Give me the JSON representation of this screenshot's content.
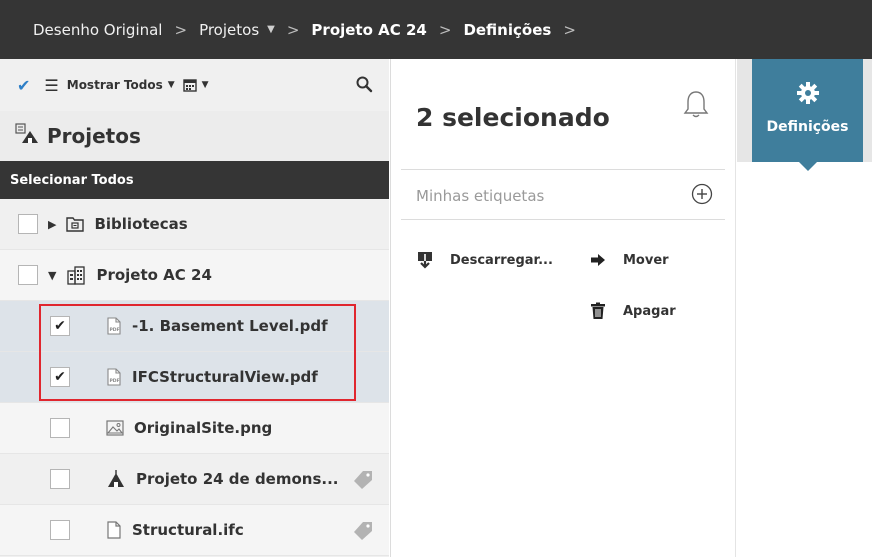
{
  "breadcrumb": {
    "items": [
      {
        "label": "Desenho Original"
      },
      {
        "label": "Projetos"
      },
      {
        "label": "Projeto AC 24"
      },
      {
        "label": "Definições"
      }
    ],
    "separator": ">"
  },
  "toolbar": {
    "filter_label": "Mostrar Todos"
  },
  "left_panel": {
    "title": "Projetos",
    "select_all": "Selecionar Todos",
    "items": [
      {
        "label": "Bibliotecas",
        "checked": false,
        "icon": "library-folder-icon"
      },
      {
        "label": "Projeto AC 24",
        "checked": false,
        "icon": "building-icon"
      },
      {
        "label": "-1. Basement Level.pdf",
        "checked": true,
        "icon": "pdf-file-icon"
      },
      {
        "label": "IFCStructuralView.pdf",
        "checked": true,
        "icon": "pdf-file-icon"
      },
      {
        "label": "OriginalSite.png",
        "checked": false,
        "icon": "image-file-icon"
      },
      {
        "label": "Projeto 24 de demons...",
        "checked": false,
        "icon": "project-icon",
        "tagged": true
      },
      {
        "label": "Structural.ifc",
        "checked": false,
        "icon": "file-icon",
        "tagged": true
      }
    ]
  },
  "selection_panel": {
    "title": "2 selecionado",
    "tags_placeholder": "Minhas etiquetas",
    "actions": {
      "download": "Descarregar...",
      "move": "Mover",
      "delete": "Apagar"
    }
  },
  "right_panel": {
    "settings_label": "Definições"
  },
  "colors": {
    "topbar": "#353535",
    "accent": "#3f7e9c",
    "highlight": "#e0262e",
    "check": "#2e7fc7"
  }
}
